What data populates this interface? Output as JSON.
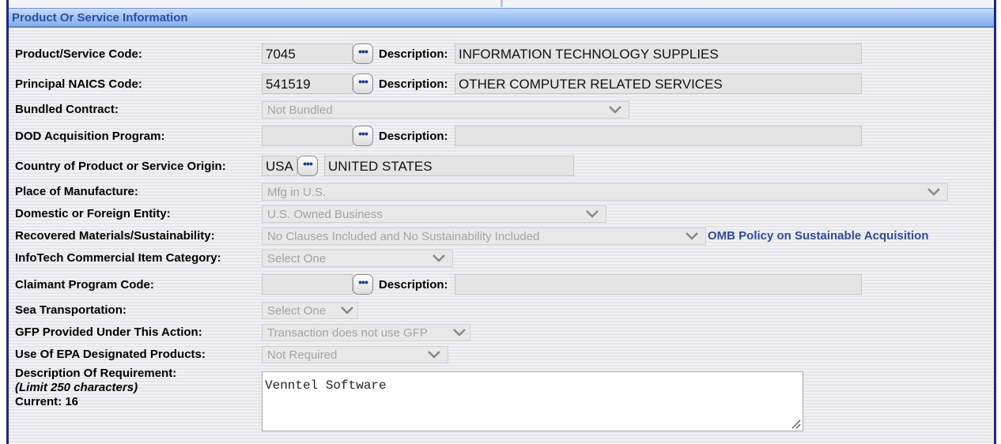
{
  "section": {
    "title": "Product Or Service Information"
  },
  "rows": {
    "psc": {
      "label": "Product/Service Code:",
      "value": "7045",
      "desc_label": "Description:",
      "desc_value": "INFORMATION TECHNOLOGY SUPPLIES"
    },
    "naics": {
      "label": "Principal NAICS Code:",
      "value": "541519",
      "desc_label": "Description:",
      "desc_value": "OTHER COMPUTER RELATED SERVICES"
    },
    "bundled": {
      "label": "Bundled Contract:",
      "selected": "Not Bundled"
    },
    "dod": {
      "label": "DOD Acquisition Program:",
      "value": "",
      "desc_label": "Description:",
      "desc_value": ""
    },
    "country": {
      "label": "Country of Product or Service Origin:",
      "code": "USA",
      "name": "UNITED STATES"
    },
    "place": {
      "label": "Place of Manufacture:",
      "selected": "Mfg in U.S."
    },
    "domestic": {
      "label": "Domestic or Foreign Entity:",
      "selected": "U.S. Owned Business"
    },
    "recovered": {
      "label": "Recovered Materials/Sustainability:",
      "selected": "No Clauses Included and No Sustainability Included",
      "link": "OMB Policy on Sustainable Acquisition"
    },
    "infotech": {
      "label": "InfoTech Commercial Item Category:",
      "selected": "Select One"
    },
    "claimant": {
      "label": "Claimant Program Code:",
      "value": "",
      "desc_label": "Description:",
      "desc_value": ""
    },
    "sea": {
      "label": "Sea Transportation:",
      "selected": "Select One"
    },
    "gfp": {
      "label": "GFP Provided Under This Action:",
      "selected": "Transaction does not use GFP"
    },
    "epa": {
      "label": "Use Of EPA Designated Products:",
      "selected": "Not Required"
    },
    "requirement": {
      "label": "Description Of Requirement:",
      "limit": "(Limit 250 characters)",
      "current": "Current: 16",
      "value": "Venntel Software"
    }
  },
  "icons": {
    "lookup": "ellipsis-lookup-icon",
    "dropdown": "chevron-down-icon",
    "resize": "resize-grip-icon"
  },
  "colors": {
    "header_text": "#2c4f9b",
    "link": "#2d4c9a",
    "frame_border": "#1a2a8c"
  }
}
